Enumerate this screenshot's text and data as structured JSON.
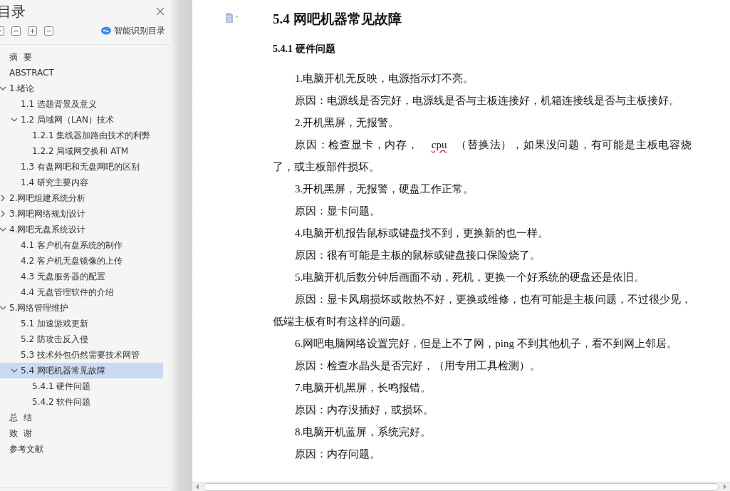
{
  "sidebar": {
    "title": "目录",
    "smart_button": "智能识别目录",
    "tree": [
      {
        "label": "摘  要",
        "selected": false
      },
      {
        "label": "ABSTRACT",
        "selected": false
      },
      {
        "label": "1.绪论",
        "selected": false,
        "expanded": true,
        "children": [
          {
            "label": "1.1 选题背景及意义",
            "selected": false
          },
          {
            "label": "1.2 局域网（LAN）技术",
            "selected": false,
            "expanded": true,
            "children": [
              {
                "label": "1.2.1 集线器加路由技术的利弊",
                "selected": false
              },
              {
                "label": "1.2.2 局域网交换和 ATM",
                "selected": false
              }
            ]
          },
          {
            "label": "1.3 有盘网吧和无盘网吧的区别",
            "selected": false
          },
          {
            "label": "1.4 研究主要内容",
            "selected": false
          }
        ]
      },
      {
        "label": "2.网吧组建系统分析",
        "selected": false,
        "expanded": false
      },
      {
        "label": "3.网吧网络规划设计",
        "selected": false,
        "expanded": false
      },
      {
        "label": "4.网吧无盘系统设计",
        "selected": false,
        "expanded": true,
        "children": [
          {
            "label": "4.1 客户机有盘系统的制作",
            "selected": false
          },
          {
            "label": "4.2 客户机无盘镜像的上传",
            "selected": false
          },
          {
            "label": "4.3 无盘服务器的配置",
            "selected": false
          },
          {
            "label": "4.4 无盘管理软件的介绍",
            "selected": false
          }
        ]
      },
      {
        "label": "5.网络管理维护",
        "selected": false,
        "expanded": true,
        "children": [
          {
            "label": "5.1 加速游戏更新",
            "selected": false
          },
          {
            "label": "5.2 防攻击反入侵",
            "selected": false
          },
          {
            "label": "5.3 技术外包仍然需要技术网管",
            "selected": false
          },
          {
            "label": "5.4 网吧机器常见故障",
            "selected": true,
            "expanded": true,
            "children": [
              {
                "label": "5.4.1 硬件问题",
                "selected": false
              },
              {
                "label": "5.4.2 软件问题",
                "selected": false
              }
            ]
          }
        ]
      },
      {
        "label": "总  结",
        "selected": false
      },
      {
        "label": "致  谢",
        "selected": false
      },
      {
        "label": "参考文献",
        "selected": false
      }
    ]
  },
  "document": {
    "heading": "5.4 网吧机器常见故障",
    "subheading": "5.4.1 硬件问题",
    "paragraphs": [
      {
        "segments": [
          {
            "text": "1.电脑开机无反映，电源指示灯不亮。"
          }
        ]
      },
      {
        "segments": [
          {
            "text": "原因：电源线是否完好，电源线是否与主板连接好，机箱连接线是否与主板接好。"
          }
        ]
      },
      {
        "segments": [
          {
            "text": "2.开机黑屏，无报警。"
          }
        ]
      },
      {
        "segments": [
          {
            "text": "原因：检查显卡，内存，"
          },
          {
            "text": "cpu",
            "misspelled": true
          },
          {
            "text": "（替换法），如果没问题，有可能是主板电容烧了，或主板部件损坏。"
          }
        ]
      },
      {
        "segments": [
          {
            "text": "3.开机黑屏，无报警，硬盘工作正常。"
          }
        ]
      },
      {
        "segments": [
          {
            "text": "原因：显卡问题。"
          }
        ]
      },
      {
        "segments": [
          {
            "text": "4.电脑开机报告鼠标或键盘找不到，更换新的也一样。"
          }
        ]
      },
      {
        "segments": [
          {
            "text": "原因：很有可能是主板的鼠标或键盘接口保险烧了。"
          }
        ]
      },
      {
        "segments": [
          {
            "text": "5.电脑开机后数分钟后画面不动，死机，更换一个好系统的硬盘还是依旧。"
          }
        ]
      },
      {
        "segments": [
          {
            "text": "原因：显卡风扇损坏或散热不好，更换或维修，也有可能是主板问题，不过很少见，低端主板有时有这样的问题。"
          }
        ]
      },
      {
        "segments": [
          {
            "text": "6.网吧电脑网络设置完好，但是上不了网，ping 不到其他机子，看不到网上邻居。"
          }
        ]
      },
      {
        "segments": [
          {
            "text": "原因：检查水晶头是否完好，（用专用工具检测）。"
          }
        ]
      },
      {
        "segments": [
          {
            "text": "7.电脑开机黑屏，长鸣报错。"
          }
        ]
      },
      {
        "segments": [
          {
            "text": "原因：内存没插好，或损坏。"
          }
        ]
      },
      {
        "segments": [
          {
            "text": "8.电脑开机蓝屏，系统完好。"
          }
        ]
      },
      {
        "segments": [
          {
            "text": "原因：内存问题。"
          }
        ]
      }
    ]
  }
}
